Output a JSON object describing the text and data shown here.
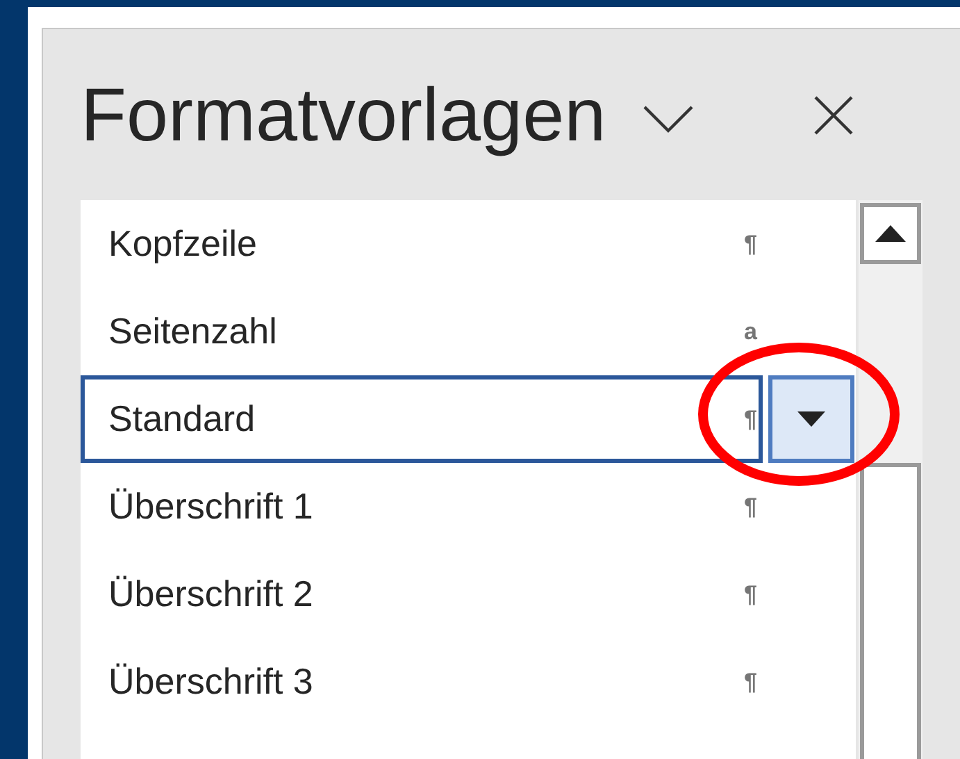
{
  "pane": {
    "title": "Formatvorlagen"
  },
  "styles": [
    {
      "name": "Kopfzeile",
      "symbol": "¶",
      "selected": false
    },
    {
      "name": "Seitenzahl",
      "symbol": "a",
      "selected": false
    },
    {
      "name": "Standard",
      "symbol": "¶",
      "selected": true
    },
    {
      "name": "Überschrift 1",
      "symbol": "¶",
      "selected": false
    },
    {
      "name": "Überschrift 2",
      "symbol": "¶",
      "selected": false
    },
    {
      "name": "Überschrift 3",
      "symbol": "¶",
      "selected": false
    }
  ]
}
